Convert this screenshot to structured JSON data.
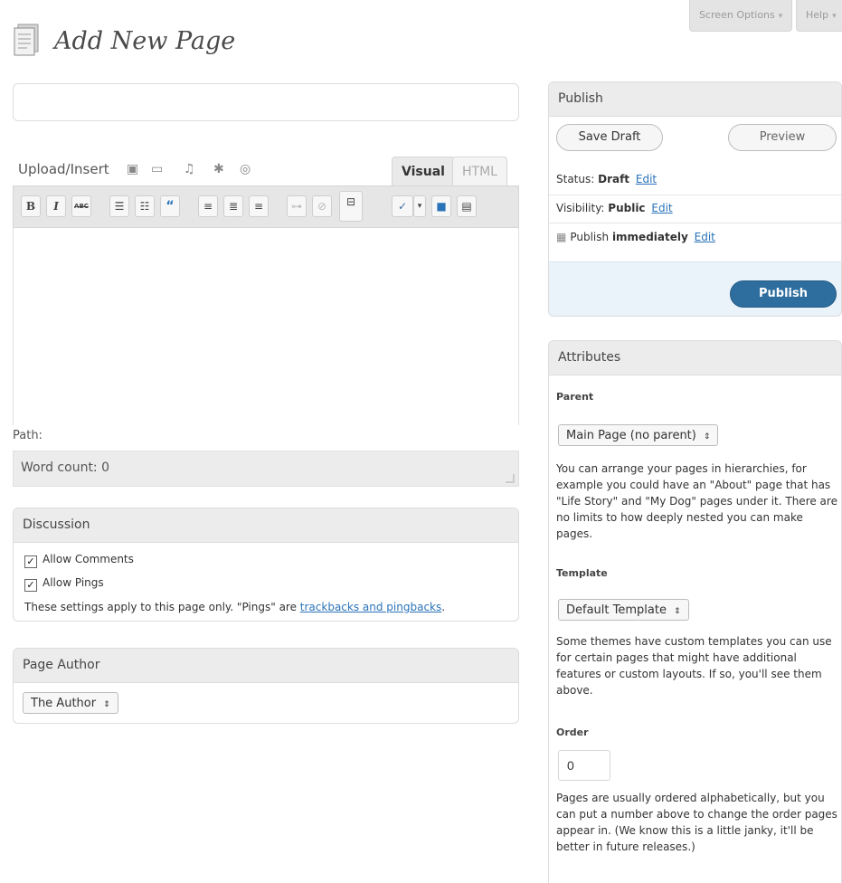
{
  "top_tabs": {
    "screen_options": "Screen Options",
    "help": "Help"
  },
  "header": {
    "title": "Add New Page"
  },
  "title_input": {
    "value": "",
    "placeholder": ""
  },
  "editor": {
    "upload_label": "Upload/Insert",
    "tabs": {
      "visual": "Visual",
      "html": "HTML"
    },
    "toolbar": {
      "bold": "B",
      "italic": "I",
      "strikethrough": "ABC",
      "blockquote": "“"
    },
    "path_label": "Path:",
    "word_count_label": "Word count: 0"
  },
  "discussion": {
    "title": "Discussion",
    "allow_comments": "Allow Comments",
    "allow_pings": "Allow Pings",
    "note_prefix": "These settings apply to this page only. \"Pings\" are ",
    "note_link": "trackbacks and pingbacks",
    "note_suffix": "."
  },
  "page_author": {
    "title": "Page Author",
    "selected": "The Author"
  },
  "publish": {
    "title": "Publish",
    "save_draft": "Save Draft",
    "preview": "Preview",
    "status_label": "Status: ",
    "status_value": "Draft",
    "visibility_label": "Visibility: ",
    "visibility_value": "Public",
    "publish_label": "Publish ",
    "publish_value": "immediately",
    "edit_link": "Edit",
    "publish_button": "Publish"
  },
  "attributes": {
    "title": "Attributes",
    "parent_label": "Parent",
    "parent_selected": "Main Page (no parent)",
    "parent_help": "You can arrange your pages in hierarchies, for example you could have an \"About\" page that has \"Life Story\" and \"My Dog\" pages under it. There are no limits to how deeply nested you can make pages.",
    "template_label": "Template",
    "template_selected": "Default Template",
    "template_help": "Some themes have custom templates you can use for certain pages that might have additional features or custom layouts. If so, you'll see them above.",
    "order_label": "Order",
    "order_value": "0",
    "order_help": "Pages are usually ordered alphabetically, but you can put a number above to change the order pages appear in. (We know this is a little janky, it'll be better in future releases.)"
  },
  "colors": {
    "link": "#2a73b8",
    "publish_button": "#2e6e9e",
    "publish_footer": "#eaf2fa"
  }
}
